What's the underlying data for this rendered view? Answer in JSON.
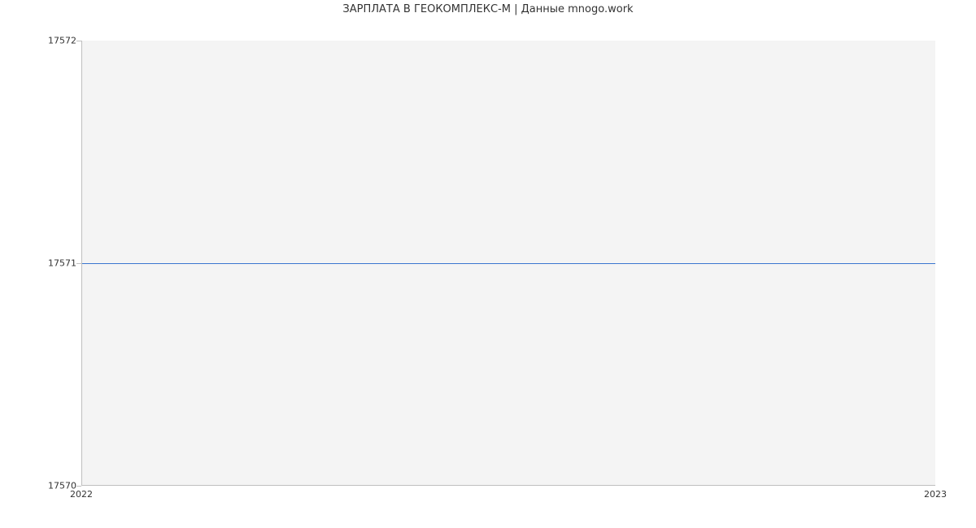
{
  "chart_data": {
    "type": "line",
    "title": "ЗАРПЛАТА В ГЕОКОМПЛЕКС-М | Данные mnogo.work",
    "xlabel": "",
    "ylabel": "",
    "x": [
      2022,
      2023
    ],
    "values": [
      17571,
      17571
    ],
    "xlim": [
      2022,
      2023
    ],
    "ylim": [
      17570,
      17572
    ],
    "x_ticks": [
      2022,
      2023
    ],
    "y_ticks": [
      17570,
      17571,
      17572
    ],
    "line_color": "#3a76d0",
    "grid": false
  }
}
